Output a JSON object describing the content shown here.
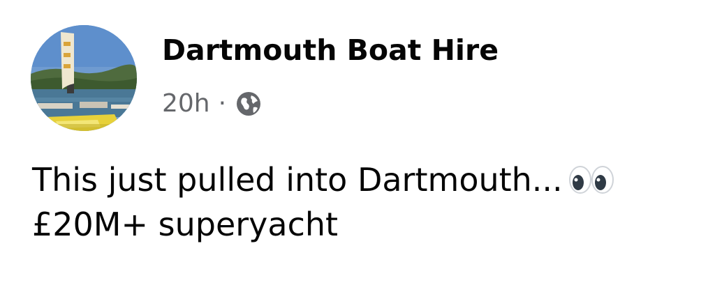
{
  "post": {
    "author": "Dartmouth Boat Hire",
    "timestamp": "20h",
    "separator": "·",
    "privacy_icon": "globe-icon",
    "text_line_1": "This just pulled into Dartmouth...",
    "text_line_2": "£20M+ superyacht",
    "emoji": "eyes-emoji"
  },
  "colors": {
    "author_text": "#050505",
    "meta_text": "#65676b",
    "background": "#ffffff"
  }
}
